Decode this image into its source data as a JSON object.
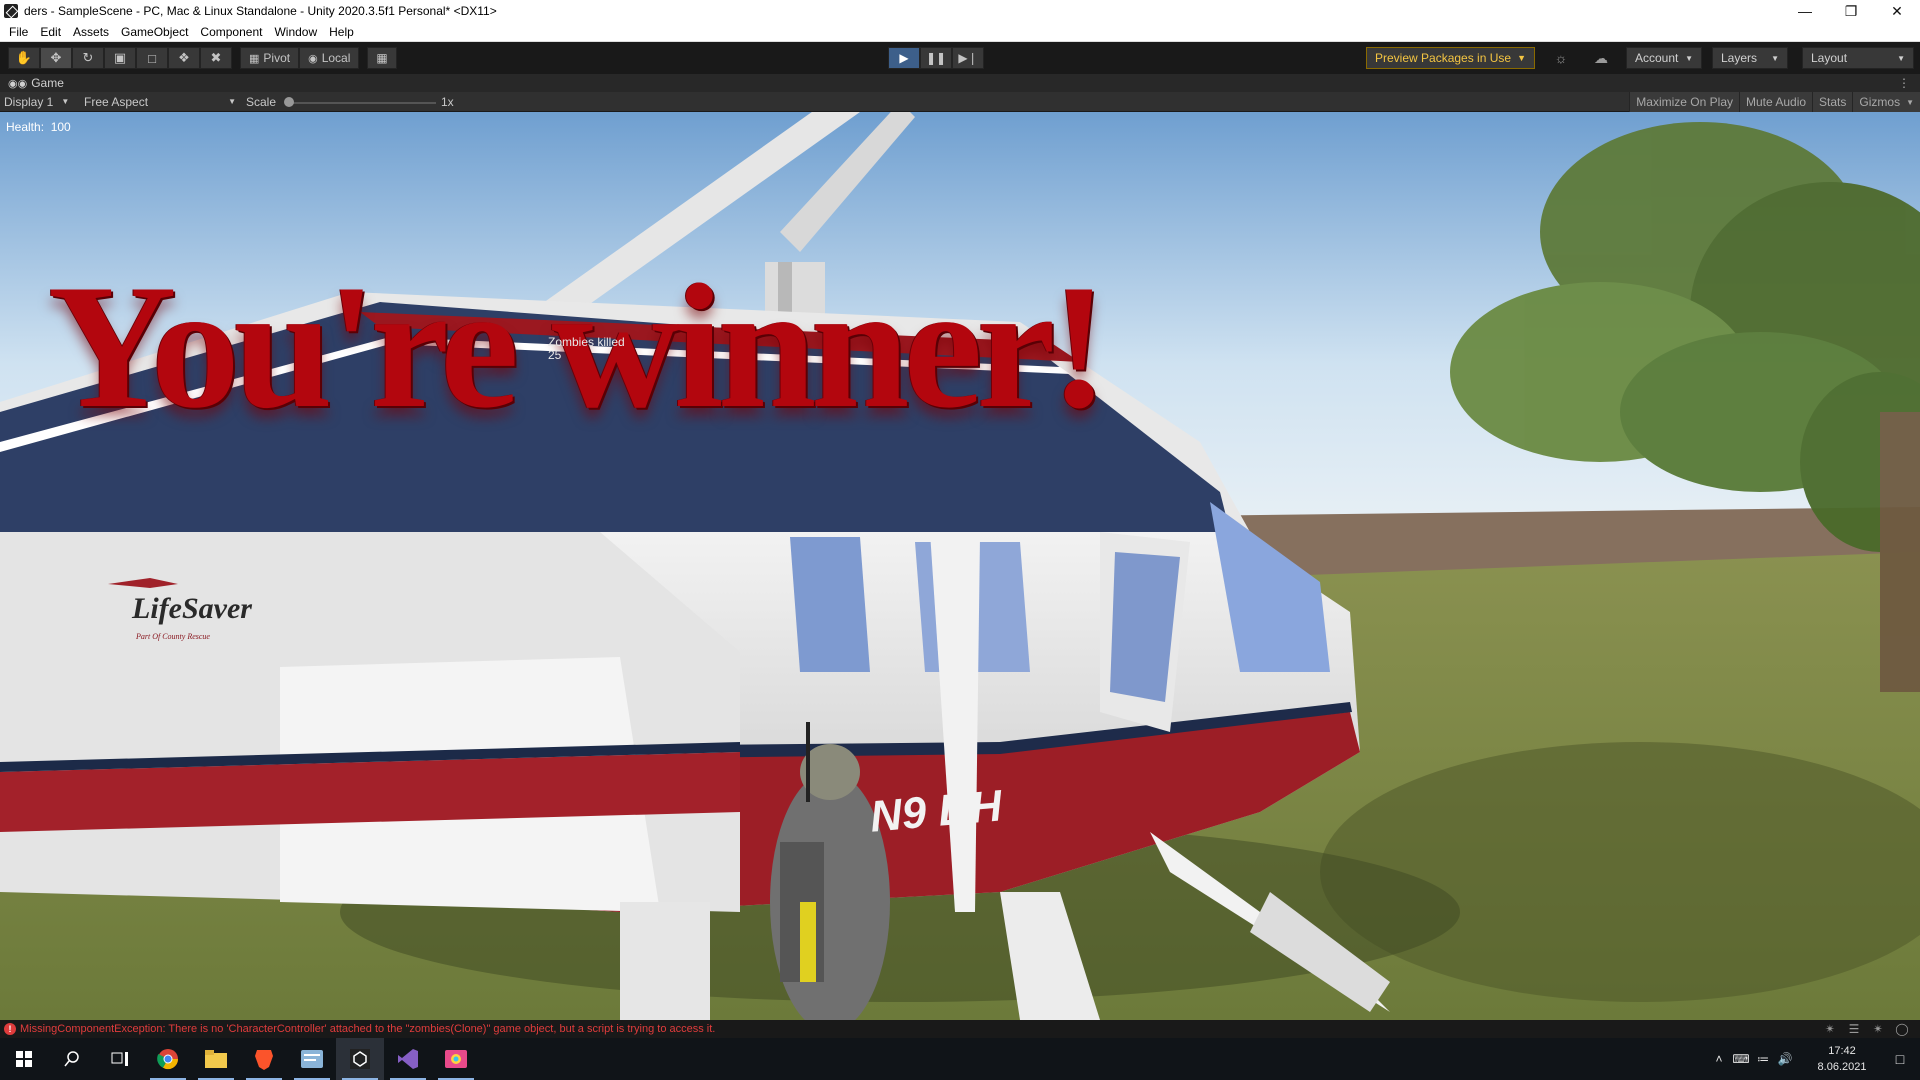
{
  "window": {
    "title": "ders - SampleScene - PC, Mac & Linux Standalone - Unity 2020.3.5f1 Personal* <DX11>",
    "controls": [
      "minimize-icon",
      "restore-icon",
      "close-icon"
    ]
  },
  "menu": [
    "File",
    "Edit",
    "Assets",
    "GameObject",
    "Component",
    "Window",
    "Help"
  ],
  "toolbar": {
    "tools": [
      "hand-tool-icon",
      "move-tool-icon",
      "rotate-tool-icon",
      "scale-tool-icon",
      "rect-tool-icon",
      "transform-tool-icon",
      "custom-tool-icon"
    ],
    "pivot_label": "Pivot",
    "local_label": "Local",
    "preview_packages": "Preview Packages in Use",
    "account": "Account",
    "layers": "Layers",
    "layout": "Layout"
  },
  "tab": {
    "game_label": "Game"
  },
  "gameview": {
    "display": "Display 1",
    "aspect": "Free Aspect",
    "scale_label": "Scale",
    "scale_value": "1x",
    "toggles": [
      "Maximize On Play",
      "Mute Audio",
      "Stats",
      "Gizmos"
    ]
  },
  "hud": {
    "health_label": "Health:",
    "health_value": "100",
    "winner": "You're winner!",
    "zombies_label": "Zombies killed",
    "zombies_value": "25"
  },
  "scene": {
    "heli_brand": "LifeSaver",
    "heli_sub": "Part Of County Rescue",
    "heli_reg": "N9 DH"
  },
  "console": {
    "error": "MissingComponentException: There is no 'CharacterController' attached to the \"zombies(Clone)\" game object, but a script is trying to access it."
  },
  "taskbar": {
    "time": "17:42",
    "date": "8.06.2021"
  },
  "colors": {
    "accent": "#3d5f8a",
    "error": "#e03c3c",
    "winner": "#b3060e",
    "warning": "#f4c542"
  }
}
